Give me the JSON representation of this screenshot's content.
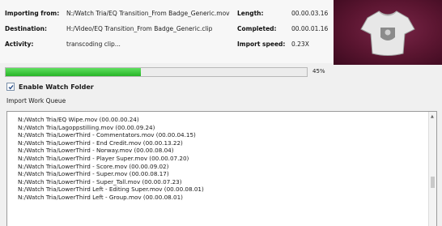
{
  "import_info": {
    "importing_from": {
      "label": "Importing from:",
      "value": "N:/Watch Tria/EQ Transition_From Badge_Generic.mov"
    },
    "destination": {
      "label": "Destination:",
      "value": "H:/Video/EQ Transition_From Badge_Generic.clip"
    },
    "activity": {
      "label": "Activity:",
      "value": "transcoding clip..."
    },
    "length": {
      "label": "Length:",
      "value": "00.00.03.16"
    },
    "completed": {
      "label": "Completed:",
      "value": "00.00.01.16"
    },
    "import_speed": {
      "label": "Import speed:",
      "value": "0.23X"
    }
  },
  "progress": {
    "fraction": 0.45,
    "label": "45%"
  },
  "watch_folder": {
    "label": "Enable Watch Folder",
    "checked": true
  },
  "queue": {
    "title": "Import Work Queue",
    "items": [
      "N:/Watch Tria/EQ Wipe.mov (00.00.00.24)",
      "N:/Watch Tria/Lagoppstilling.mov (00.00.09.24)",
      "N:/Watch Tria/LowerThird - Commentators.mov (00.00.04.15)",
      "N:/Watch Tria/LowerThird - End Credit.mov (00.00.13.22)",
      "N:/Watch Tria/LowerThird - Norway.mov (00.00.08.04)",
      "N:/Watch Tria/LowerThird - Player Super.mov (00.00.07.20)",
      "N:/Watch Tria/LowerThird - Score.mov (00.00.09.02)",
      "N:/Watch Tria/LowerThird - Super.mov (00.00.08.17)",
      "N:/Watch Tria/LowerThird - Super_Tall.mov (00.00.07.23)",
      "N:/Watch Tria/LowerThird Left - Editing Super.mov (00.00.08.01)",
      "N:/Watch Tria/LowerThird Left - Group.mov (00.00.08.01)"
    ]
  },
  "colors": {
    "progress_fill": "#27b427",
    "thumbnail_bg": "#5a1530"
  },
  "icons": {
    "checkbox": "checkmark-icon",
    "thumbnail": "jersey-badge-icon",
    "scroll": "scroll-up-arrow-icon"
  }
}
